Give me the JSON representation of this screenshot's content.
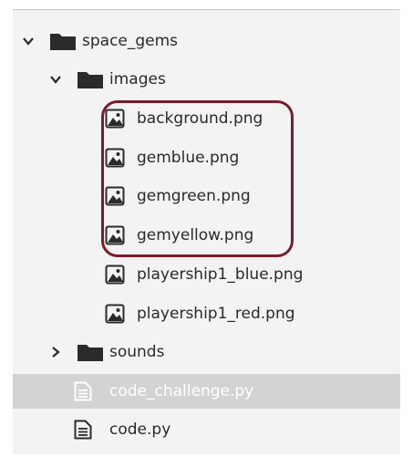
{
  "tree": {
    "root": {
      "label": "space_gems",
      "expanded": true
    },
    "images_folder": {
      "label": "images",
      "expanded": true
    },
    "images": [
      {
        "label": "background.png",
        "icon": "image-file-icon"
      },
      {
        "label": "gemblue.png",
        "icon": "image-file-icon"
      },
      {
        "label": "gemgreen.png",
        "icon": "image-file-icon"
      },
      {
        "label": "gemyellow.png",
        "icon": "image-file-icon"
      },
      {
        "label": "playership1_blue.png",
        "icon": "image-file-icon"
      },
      {
        "label": "playership1_red.png",
        "icon": "image-file-icon"
      }
    ],
    "sounds_folder": {
      "label": "sounds",
      "expanded": false
    },
    "files": [
      {
        "label": "code_challenge.py",
        "icon": "text-file-icon",
        "selected": true
      },
      {
        "label": "code.py",
        "icon": "text-file-icon",
        "selected": false
      }
    ]
  },
  "colors": {
    "panel_background": "#f3f3f3",
    "selected_row": "#d3d3d3",
    "highlight_border": "#7a1c2e",
    "folder": "#2b2b2b"
  }
}
